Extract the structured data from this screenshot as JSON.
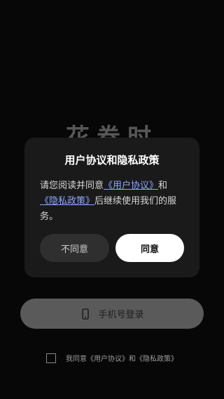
{
  "app": {
    "logo_text": "花卷时"
  },
  "login": {
    "phone_login_label": "手机号登录",
    "phone_icon": "phone-icon"
  },
  "agreement": {
    "text_prefix": "我同意",
    "user_agreement": "《用户协议》",
    "conjunction": "和",
    "privacy_policy": "《隐私政策》"
  },
  "dialog": {
    "title": "用户协议和隐私政策",
    "body_prefix": "请您阅读并同意",
    "user_agreement_link": "《用户协议》",
    "conjunction": "和",
    "privacy_policy_link": "《隐私政策》",
    "body_suffix": "后继续使用我们的服务。",
    "decline_label": "不同意",
    "accept_label": "同意"
  },
  "colors": {
    "background": "#070707",
    "dialog_background": "#1a1a1a",
    "link": "#8ea8ff",
    "accept_button": "#ffffff",
    "decline_button": "#2f2f2f",
    "login_button": "#5a5a5a"
  }
}
